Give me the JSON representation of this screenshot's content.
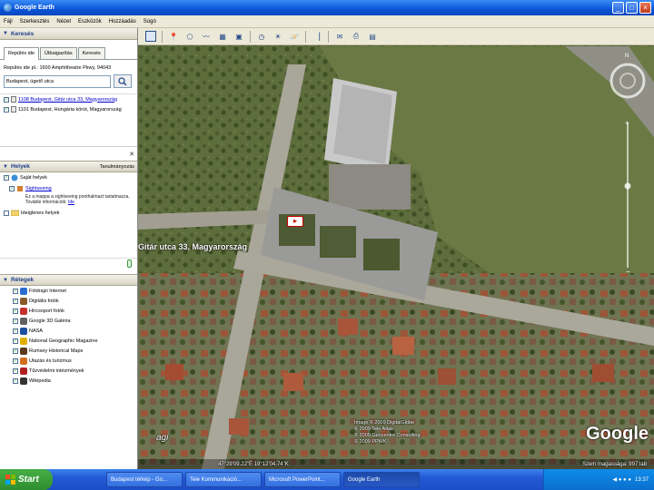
{
  "window": {
    "title": "Google Earth",
    "buttons": [
      "_",
      "□",
      "×"
    ]
  },
  "menu": [
    "Fájl",
    "Szerkesztés",
    "Nézet",
    "Eszközök",
    "Hozzáadás",
    "Súgó"
  ],
  "search_panel": {
    "header": "Keresés",
    "tabs": [
      "Repülés ide",
      "Útbaigazítás",
      "Keresés"
    ],
    "hint": "Repülés ide pl.: 1600 Amphitheatre Pkwy, 94043",
    "input_value": "Budapest, ügető utca",
    "results": [
      {
        "text": "1108 Budapest, Gitár utca 33, Magyarország",
        "checked": true
      },
      {
        "text": "1101 Budapest, Hungária körút, Magyarország",
        "checked": true
      }
    ]
  },
  "places_panel": {
    "header": "Helyek",
    "tab2": "Tanulmányozás",
    "items": [
      {
        "label": "Saját helyek",
        "type": "folder"
      },
      {
        "label": "Sightseeing",
        "type": "link",
        "sub": "Ez a mappa a sightseeing ponthalmazt tartalmazza. További információk:"
      },
      {
        "label": "Ideiglenes helyek",
        "type": "folder"
      }
    ],
    "link_more": "Ide"
  },
  "layers_panel": {
    "header": "Rétegek",
    "items": [
      {
        "label": "Földrajzi Internet",
        "color": "#2a6fd0"
      },
      {
        "label": "Digitális fotók",
        "color": "#8a5a2a"
      },
      {
        "label": "Hírcsoport fotók",
        "color": "#c83030"
      },
      {
        "label": "Google 3D Galéria",
        "color": "#606060"
      },
      {
        "label": "NASA",
        "color": "#1e4fa0"
      },
      {
        "label": "National Geographic Magazine",
        "color": "#e0b000"
      },
      {
        "label": "Rumsey Historical Maps",
        "color": "#5a3a1a"
      },
      {
        "label": "Utazás és turizmus",
        "color": "#d07020"
      },
      {
        "label": "Tűzvédelmi intézmények",
        "color": "#b02020"
      },
      {
        "label": "Wikipedia",
        "color": "#333333"
      }
    ]
  },
  "map": {
    "address_label": "Gitár utca 33, Magyarország",
    "credits": [
      "Image © 2009 DigitalGlobe",
      "© 2009 Tele Atlas",
      "© 2009 Geocentre Consulting",
      "© 2009 PPWK"
    ],
    "coords": "47°29'09.22\"É   19°12'04.74\"K",
    "eye_altitude": "Szem magassága: 997 láb",
    "logo": "Google",
    "badge": "agi",
    "compass_n": "N"
  },
  "taskbar": {
    "start": "Start",
    "buttons": [
      "Budapest térkép - Go...",
      "Tele Kommunikáció...",
      "Microsoft PowerPoint...",
      "Google Earth"
    ],
    "active_index": 3,
    "clock": "13:37"
  }
}
